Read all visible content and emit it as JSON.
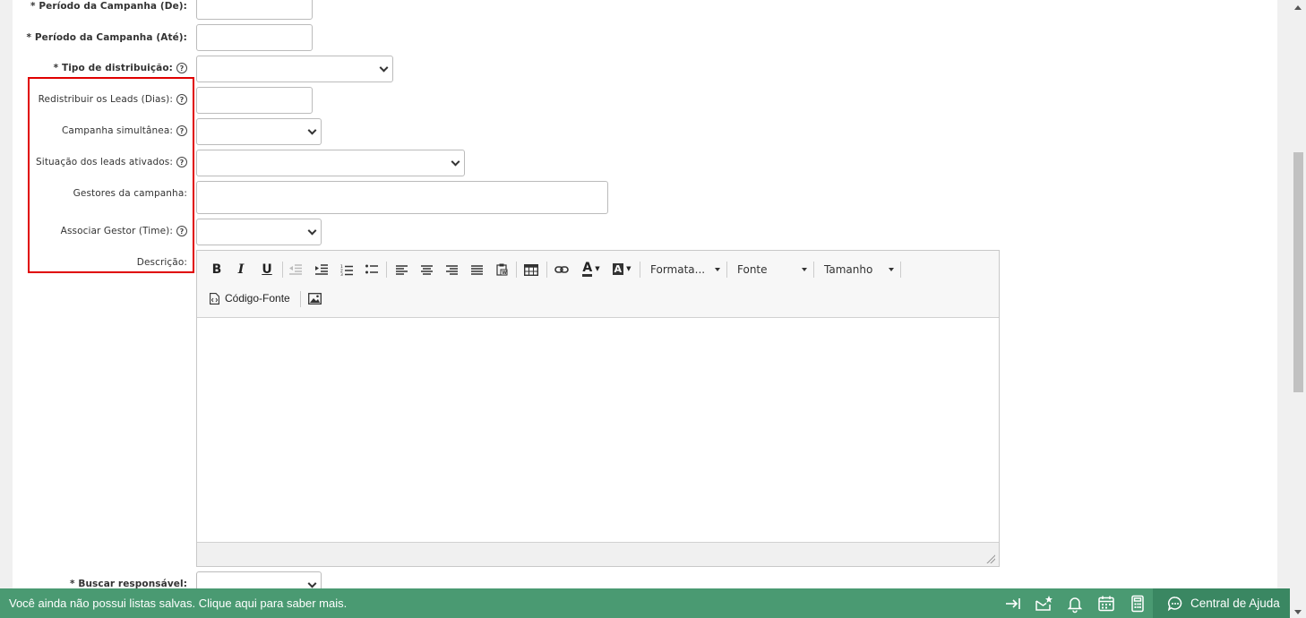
{
  "form": {
    "labels": {
      "periodo_de": "* Período da Campanha (De):",
      "periodo_ate": "* Período da Campanha (Até):",
      "tipo_distribuicao": "* Tipo de distribuição:",
      "redistribuir": "Redistribuir os Leads (Dias):",
      "simultanea": "Campanha simultânea:",
      "situacao": "Situação dos leads ativados:",
      "gestores": "Gestores da campanha:",
      "associar": "Associar Gestor (Time):",
      "descricao": "Descrição:",
      "buscar": "* Buscar responsável:"
    },
    "help_glyph": "?"
  },
  "editor": {
    "combos": {
      "format": "Formata...",
      "font": "Fonte",
      "size": "Tamanho"
    },
    "source_label": "Código-Fonte",
    "font_color_letter": "A",
    "bg_color_letter": "A"
  },
  "bottom_bar": {
    "message": "Você ainda não possui listas salvas. Clique aqui para saber mais.",
    "help_label": "Central de Ajuda",
    "icons": [
      "exit-icon",
      "mail-star-icon",
      "bell-icon",
      "calendar-icon",
      "calculator-icon",
      "chat-icon"
    ]
  },
  "colors": {
    "highlight_border": "#e00000",
    "bottom_bar": "#4a9a72",
    "help_button": "#3a8762"
  }
}
